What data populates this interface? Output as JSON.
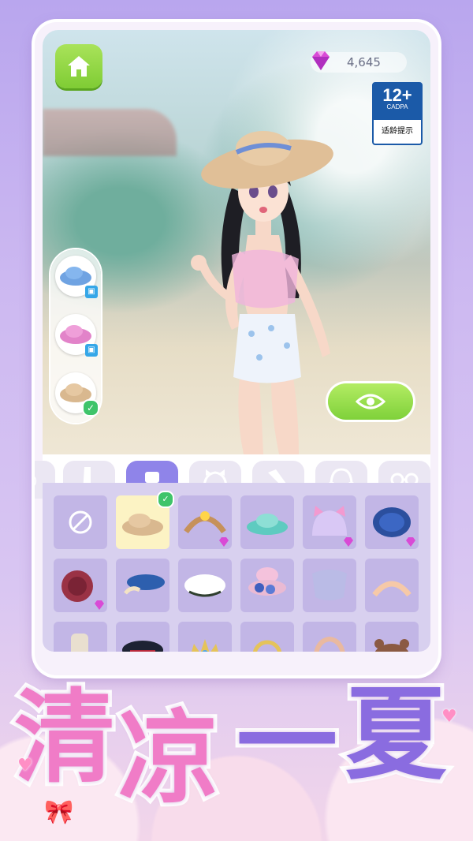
{
  "hud": {
    "gems": "4,645",
    "age_rating": "12+",
    "age_org": "CADPA",
    "age_hint": "适龄提示"
  },
  "icons": {
    "home": "home-icon",
    "gem": "diamond-icon",
    "eye": "eye-icon"
  },
  "categories": [
    {
      "name": "hair",
      "icon": "hair-icon"
    },
    {
      "name": "boots",
      "icon": "boot-icon"
    },
    {
      "name": "hats",
      "icon": "hat-icon",
      "active": true
    },
    {
      "name": "cat-ears",
      "icon": "ears-icon"
    },
    {
      "name": "hairpin",
      "icon": "hairpin-icon"
    },
    {
      "name": "headphones",
      "icon": "headphones-icon"
    },
    {
      "name": "glasses",
      "icon": "glasses-icon"
    }
  ],
  "slogan": [
    "清",
    "凉",
    "一",
    "夏"
  ],
  "colors": {
    "accent": "#8f84e9",
    "green": "#7fd13a",
    "slogan_pink": "#f07cc7",
    "slogan_purple": "#8a6ce0"
  }
}
